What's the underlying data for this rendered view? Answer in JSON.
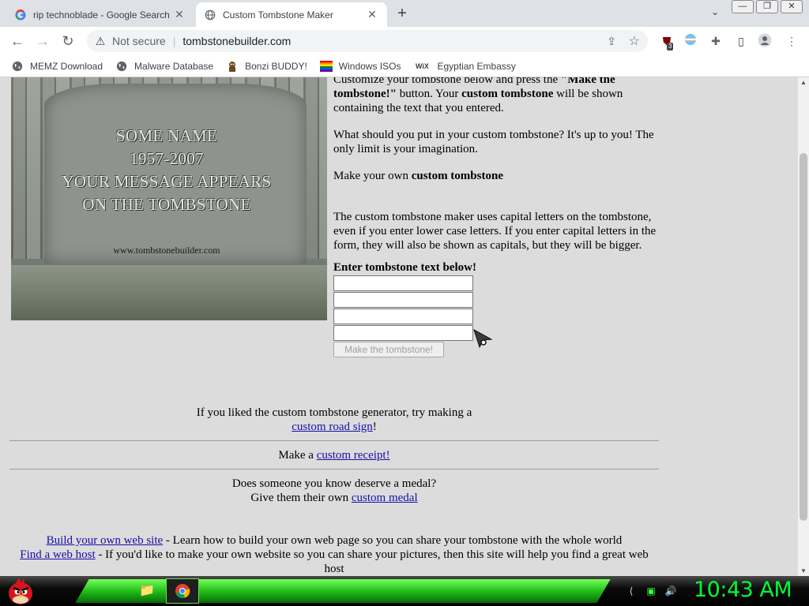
{
  "tabs": [
    {
      "title": "rip technoblade - Google Search",
      "icon": "google-icon",
      "close": "✕"
    },
    {
      "title": "Custom Tombstone Maker",
      "icon": "globe-icon",
      "close": "✕"
    }
  ],
  "new_tab_label": "+",
  "tab_search_glyph": "⌄",
  "window_controls": {
    "minimize": "—",
    "restore": "❐",
    "close": "✕"
  },
  "toolbar": {
    "back": "←",
    "forward": "→",
    "reload": "↻",
    "security_label": "Not secure",
    "url": "tombstonebuilder.com",
    "ublock_badge": "3"
  },
  "bookmarks": [
    {
      "label": "MEMZ Download",
      "icon": "globe-icon"
    },
    {
      "label": "Malware Database",
      "icon": "globe-icon"
    },
    {
      "label": "Bonzi BUDDY!",
      "icon": "bonzi-icon"
    },
    {
      "label": "Windows ISOs",
      "icon": "rainbow-flag-icon"
    },
    {
      "label": "Egyptian Embassy",
      "icon": "wix-icon"
    }
  ],
  "tombstone": {
    "line1": "SOME NAME",
    "line2": "1957-2007",
    "line3": "YOUR MESSAGE APPEARS",
    "line4": "ON THE TOMBSTONE",
    "watermark": "www.tombstonebuilder.com"
  },
  "content": {
    "intro_a": "Customize your tombstone below and press the ",
    "intro_b": "\"Make the tombstone!\"",
    "intro_c": " button. Your ",
    "intro_d": "custom tombstone",
    "intro_e": " will be shown containing the text that you entered.",
    "question": "What should you put in your custom tombstone? It's up to you! The only limit is your imagination.",
    "make_own_a": "Make your own ",
    "make_own_b": "custom tombstone",
    "caps_note": "The custom tombstone maker uses capital letters on the tombstone, even if you enter lower case letters. If you enter capital letters in the form, they will also be shown as capitals, but they will be bigger.",
    "enter_label": "Enter tombstone text below!",
    "input_values": [
      "",
      "",
      "",
      ""
    ],
    "submit_label": "Make the tombstone!"
  },
  "footer": {
    "road_text": "If you liked the custom tombstone generator, try making a",
    "road_link": "custom road sign",
    "road_end": "!",
    "receipt_text": "Make a ",
    "receipt_link": "custom receipt!",
    "medal_line1": "Does someone you know deserve a medal?",
    "medal_text": "Give them their own ",
    "medal_link": "custom medal",
    "build_link": "Build your own web site",
    "build_text": " - Learn how to build your own web page so you can share your tombstone with the whole world",
    "host_link": "Find a web host",
    "host_text": " - If you'd like to make your own website so you can share your pictures, then this site will help you find a great web host"
  },
  "taskbar": {
    "clock": "10:43 AM",
    "accent_color": "#00ff30"
  }
}
